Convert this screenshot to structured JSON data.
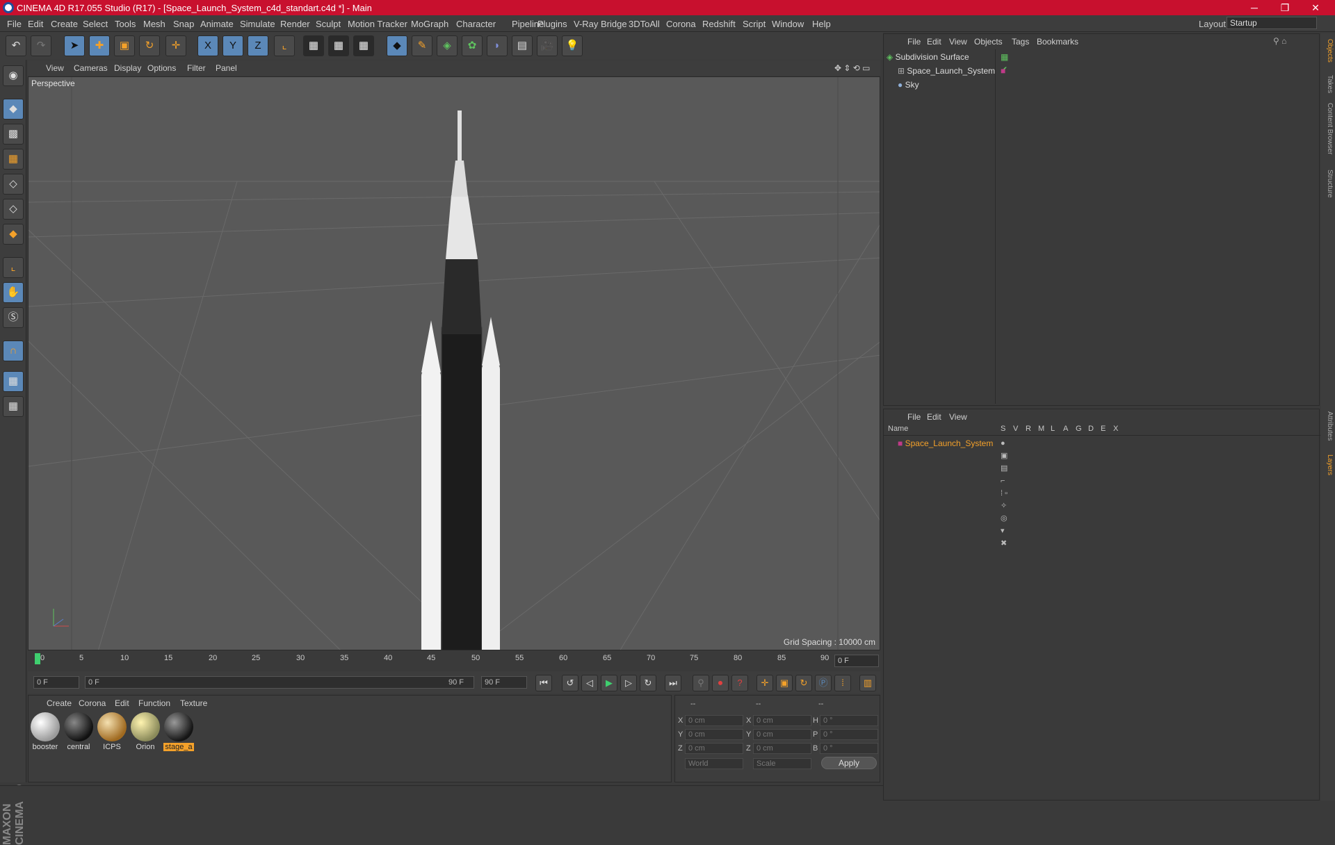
{
  "window": {
    "title": "CINEMA 4D R17.055 Studio (R17) - [Space_Launch_System_c4d_standart.c4d *] - Main",
    "minimize": "─",
    "restore": "❐",
    "close": "✕"
  },
  "menu": [
    "File",
    "Edit",
    "Create",
    "Select",
    "Tools",
    "Mesh",
    "Snap",
    "Animate",
    "Simulate",
    "Render",
    "Sculpt",
    "Motion Tracker",
    "MoGraph",
    "Character",
    "Pipeline",
    "Plugins",
    "V-Ray Bridge",
    "3DToAll",
    "Corona",
    "Redshift",
    "Script",
    "Window",
    "Help"
  ],
  "layout": {
    "label": "Layout:",
    "value": "Startup"
  },
  "toolbar": {
    "x": "X",
    "y": "Y",
    "z": "Z"
  },
  "viewport": {
    "menu": [
      "View",
      "Cameras",
      "Display",
      "Options",
      "Filter",
      "Panel"
    ],
    "label": "Perspective",
    "grid_spacing": "Grid Spacing : 10000 cm"
  },
  "timeline": {
    "ticks": [
      "0",
      "5",
      "10",
      "15",
      "20",
      "25",
      "30",
      "35",
      "40",
      "45",
      "50",
      "55",
      "60",
      "65",
      "70",
      "75",
      "80",
      "85",
      "90"
    ],
    "frame": "0 F"
  },
  "transport": {
    "start": "0 F",
    "range_start": "0 F",
    "range_end": "90 F",
    "end": "90 F"
  },
  "materials": {
    "menu": [
      "Create",
      "Corona",
      "Edit",
      "Function",
      "Texture"
    ],
    "items": [
      "booster",
      "central",
      "ICPS",
      "Orion",
      "stage_a"
    ]
  },
  "coords": {
    "headers": [
      "--",
      "--",
      "--"
    ],
    "labels": [
      "X",
      "Y",
      "Z",
      "X",
      "Y",
      "Z",
      "H",
      "P",
      "B"
    ],
    "values": [
      "0 cm",
      "0 cm",
      "0 cm",
      "0 cm",
      "0 cm",
      "0 cm",
      "0 °",
      "0 °",
      "0 °"
    ],
    "mode1": "World",
    "mode2": "Scale",
    "apply": "Apply"
  },
  "objects": {
    "menu": [
      "File",
      "Edit",
      "View",
      "Objects",
      "Tags",
      "Bookmarks"
    ],
    "items": [
      "Subdivision Surface",
      "Space_Launch_System",
      "Sky"
    ]
  },
  "layers": {
    "menu": [
      "File",
      "Edit",
      "View"
    ],
    "columns": [
      "Name",
      "S",
      "V",
      "R",
      "M",
      "L",
      "A",
      "G",
      "D",
      "E",
      "X"
    ],
    "item": "Space_Launch_System"
  },
  "right_tabs": [
    "Objects",
    "Takes",
    "Content Browser",
    "Structure",
    "Attributes",
    "Layers"
  ],
  "colors": {
    "title": "#c8102e",
    "accent": "#f4a12a",
    "active_blue": "#5b88b8",
    "layer_pink": "#c03a88"
  }
}
